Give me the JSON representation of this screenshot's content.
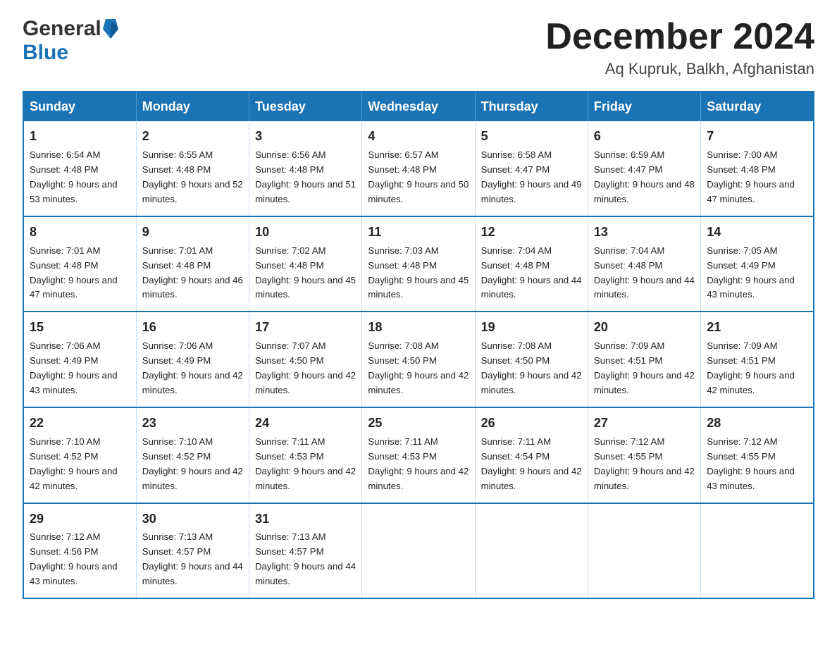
{
  "header": {
    "logo_general": "General",
    "logo_blue": "Blue",
    "month_title": "December 2024",
    "location": "Aq Kupruk, Balkh, Afghanistan"
  },
  "days_of_week": [
    "Sunday",
    "Monday",
    "Tuesday",
    "Wednesday",
    "Thursday",
    "Friday",
    "Saturday"
  ],
  "weeks": [
    [
      {
        "day": "1",
        "sunrise": "6:54 AM",
        "sunset": "4:48 PM",
        "daylight": "9 hours and 53 minutes."
      },
      {
        "day": "2",
        "sunrise": "6:55 AM",
        "sunset": "4:48 PM",
        "daylight": "9 hours and 52 minutes."
      },
      {
        "day": "3",
        "sunrise": "6:56 AM",
        "sunset": "4:48 PM",
        "daylight": "9 hours and 51 minutes."
      },
      {
        "day": "4",
        "sunrise": "6:57 AM",
        "sunset": "4:48 PM",
        "daylight": "9 hours and 50 minutes."
      },
      {
        "day": "5",
        "sunrise": "6:58 AM",
        "sunset": "4:47 PM",
        "daylight": "9 hours and 49 minutes."
      },
      {
        "day": "6",
        "sunrise": "6:59 AM",
        "sunset": "4:47 PM",
        "daylight": "9 hours and 48 minutes."
      },
      {
        "day": "7",
        "sunrise": "7:00 AM",
        "sunset": "4:48 PM",
        "daylight": "9 hours and 47 minutes."
      }
    ],
    [
      {
        "day": "8",
        "sunrise": "7:01 AM",
        "sunset": "4:48 PM",
        "daylight": "9 hours and 47 minutes."
      },
      {
        "day": "9",
        "sunrise": "7:01 AM",
        "sunset": "4:48 PM",
        "daylight": "9 hours and 46 minutes."
      },
      {
        "day": "10",
        "sunrise": "7:02 AM",
        "sunset": "4:48 PM",
        "daylight": "9 hours and 45 minutes."
      },
      {
        "day": "11",
        "sunrise": "7:03 AM",
        "sunset": "4:48 PM",
        "daylight": "9 hours and 45 minutes."
      },
      {
        "day": "12",
        "sunrise": "7:04 AM",
        "sunset": "4:48 PM",
        "daylight": "9 hours and 44 minutes."
      },
      {
        "day": "13",
        "sunrise": "7:04 AM",
        "sunset": "4:48 PM",
        "daylight": "9 hours and 44 minutes."
      },
      {
        "day": "14",
        "sunrise": "7:05 AM",
        "sunset": "4:49 PM",
        "daylight": "9 hours and 43 minutes."
      }
    ],
    [
      {
        "day": "15",
        "sunrise": "7:06 AM",
        "sunset": "4:49 PM",
        "daylight": "9 hours and 43 minutes."
      },
      {
        "day": "16",
        "sunrise": "7:06 AM",
        "sunset": "4:49 PM",
        "daylight": "9 hours and 42 minutes."
      },
      {
        "day": "17",
        "sunrise": "7:07 AM",
        "sunset": "4:50 PM",
        "daylight": "9 hours and 42 minutes."
      },
      {
        "day": "18",
        "sunrise": "7:08 AM",
        "sunset": "4:50 PM",
        "daylight": "9 hours and 42 minutes."
      },
      {
        "day": "19",
        "sunrise": "7:08 AM",
        "sunset": "4:50 PM",
        "daylight": "9 hours and 42 minutes."
      },
      {
        "day": "20",
        "sunrise": "7:09 AM",
        "sunset": "4:51 PM",
        "daylight": "9 hours and 42 minutes."
      },
      {
        "day": "21",
        "sunrise": "7:09 AM",
        "sunset": "4:51 PM",
        "daylight": "9 hours and 42 minutes."
      }
    ],
    [
      {
        "day": "22",
        "sunrise": "7:10 AM",
        "sunset": "4:52 PM",
        "daylight": "9 hours and 42 minutes."
      },
      {
        "day": "23",
        "sunrise": "7:10 AM",
        "sunset": "4:52 PM",
        "daylight": "9 hours and 42 minutes."
      },
      {
        "day": "24",
        "sunrise": "7:11 AM",
        "sunset": "4:53 PM",
        "daylight": "9 hours and 42 minutes."
      },
      {
        "day": "25",
        "sunrise": "7:11 AM",
        "sunset": "4:53 PM",
        "daylight": "9 hours and 42 minutes."
      },
      {
        "day": "26",
        "sunrise": "7:11 AM",
        "sunset": "4:54 PM",
        "daylight": "9 hours and 42 minutes."
      },
      {
        "day": "27",
        "sunrise": "7:12 AM",
        "sunset": "4:55 PM",
        "daylight": "9 hours and 42 minutes."
      },
      {
        "day": "28",
        "sunrise": "7:12 AM",
        "sunset": "4:55 PM",
        "daylight": "9 hours and 43 minutes."
      }
    ],
    [
      {
        "day": "29",
        "sunrise": "7:12 AM",
        "sunset": "4:56 PM",
        "daylight": "9 hours and 43 minutes."
      },
      {
        "day": "30",
        "sunrise": "7:13 AM",
        "sunset": "4:57 PM",
        "daylight": "9 hours and 44 minutes."
      },
      {
        "day": "31",
        "sunrise": "7:13 AM",
        "sunset": "4:57 PM",
        "daylight": "9 hours and 44 minutes."
      },
      null,
      null,
      null,
      null
    ]
  ],
  "labels": {
    "sunrise": "Sunrise: ",
    "sunset": "Sunset: ",
    "daylight": "Daylight: "
  }
}
